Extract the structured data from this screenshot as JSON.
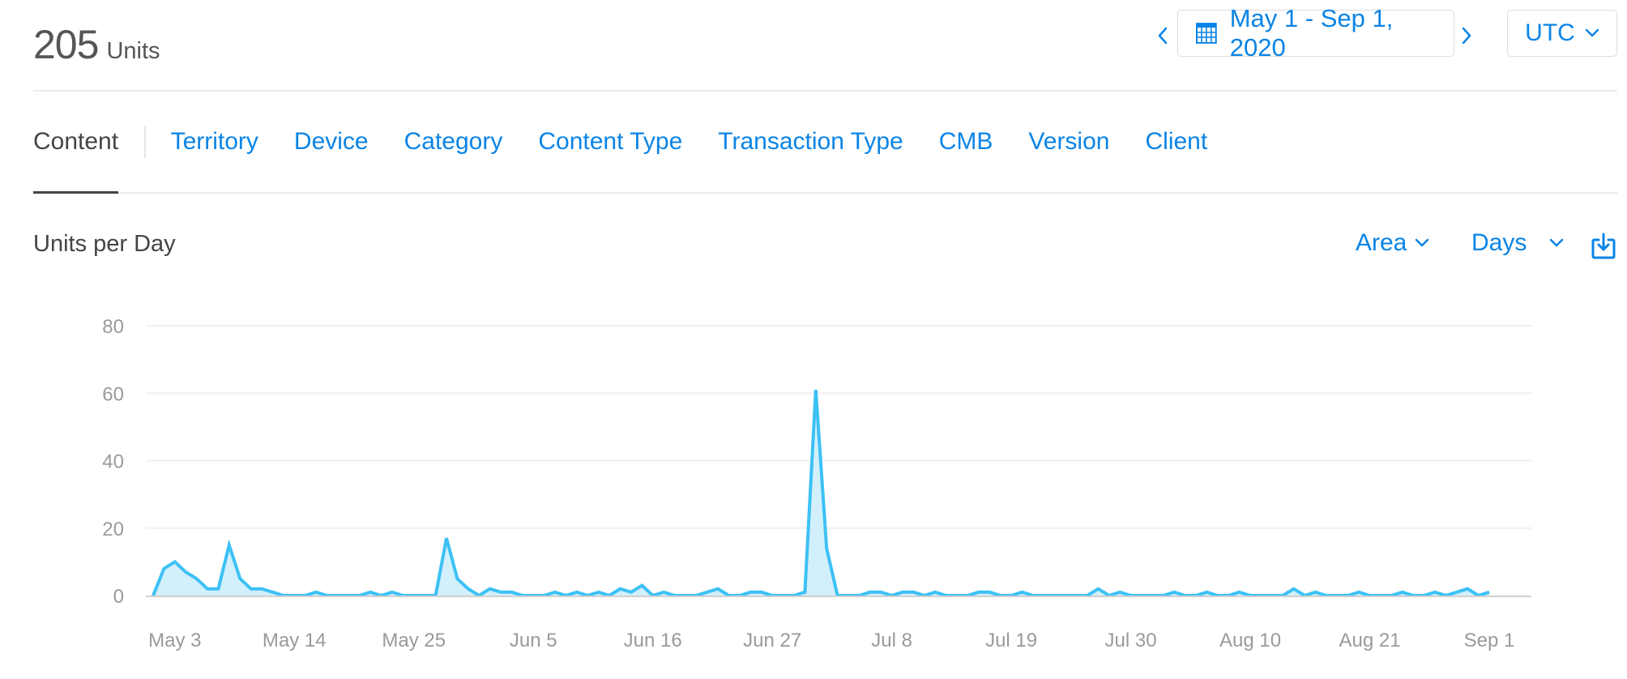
{
  "header": {
    "total_value": "205",
    "total_unit": "Units",
    "date_range": "May 1 - Sep 1, 2020",
    "timezone": "UTC",
    "icons": {
      "prev": "chevron-left-icon",
      "next": "chevron-right-icon",
      "calendar": "calendar-icon",
      "dropdown": "chevron-down-icon"
    }
  },
  "tabs": [
    {
      "label": "Content",
      "active": true
    },
    {
      "label": "Territory",
      "active": false
    },
    {
      "label": "Device",
      "active": false
    },
    {
      "label": "Category",
      "active": false
    },
    {
      "label": "Content Type",
      "active": false
    },
    {
      "label": "Transaction Type",
      "active": false
    },
    {
      "label": "CMB",
      "active": false
    },
    {
      "label": "Version",
      "active": false
    },
    {
      "label": "Client",
      "active": false
    }
  ],
  "chart_controls": {
    "title": "Units per Day",
    "chart_type": "Area",
    "period": "Days",
    "download_icon": "download-icon"
  },
  "colors": {
    "accent": "#0a84e6",
    "series_line": "#3cc1f5",
    "series_fill": "#d2effc",
    "gridline": "#f0f0f0",
    "baseline": "#d0d0d0"
  },
  "chart_data": {
    "type": "area",
    "title": "Units per Day",
    "xlabel": "",
    "ylabel": "",
    "ylim": [
      0,
      80
    ],
    "yticks": [
      0,
      20,
      40,
      60,
      80
    ],
    "grid": true,
    "legend": "none",
    "x_start": "2020-05-01",
    "x_end": "2020-09-01",
    "xtick_labels": [
      "May 3",
      "May 14",
      "May 25",
      "Jun 5",
      "Jun 16",
      "Jun 27",
      "Jul 8",
      "Jul 19",
      "Jul 30",
      "Aug 10",
      "Aug 21",
      "Sep 1"
    ],
    "xtick_day_index": [
      2,
      13,
      24,
      35,
      46,
      57,
      68,
      79,
      90,
      101,
      112,
      123
    ],
    "series": [
      {
        "name": "Units",
        "values": [
          0,
          8,
          10,
          7,
          5,
          2,
          2,
          15,
          5,
          2,
          2,
          1,
          0,
          0,
          0,
          1,
          0,
          0,
          0,
          0,
          1,
          0,
          1,
          0,
          0,
          0,
          0,
          17,
          5,
          2,
          0,
          2,
          1,
          1,
          0,
          0,
          0,
          1,
          0,
          1,
          0,
          1,
          0,
          2,
          1,
          3,
          0,
          1,
          0,
          0,
          0,
          1,
          2,
          0,
          0,
          1,
          1,
          0,
          0,
          0,
          1,
          61,
          14,
          0,
          0,
          0,
          1,
          1,
          0,
          1,
          1,
          0,
          1,
          0,
          0,
          0,
          1,
          1,
          0,
          0,
          1,
          0,
          0,
          0,
          0,
          0,
          0,
          2,
          0,
          1,
          0,
          0,
          0,
          0,
          1,
          0,
          0,
          1,
          0,
          0,
          1,
          0,
          0,
          0,
          0,
          2,
          0,
          1,
          0,
          0,
          0,
          1,
          0,
          0,
          0,
          1,
          0,
          0,
          1,
          0,
          1,
          2,
          0,
          1
        ]
      }
    ]
  }
}
